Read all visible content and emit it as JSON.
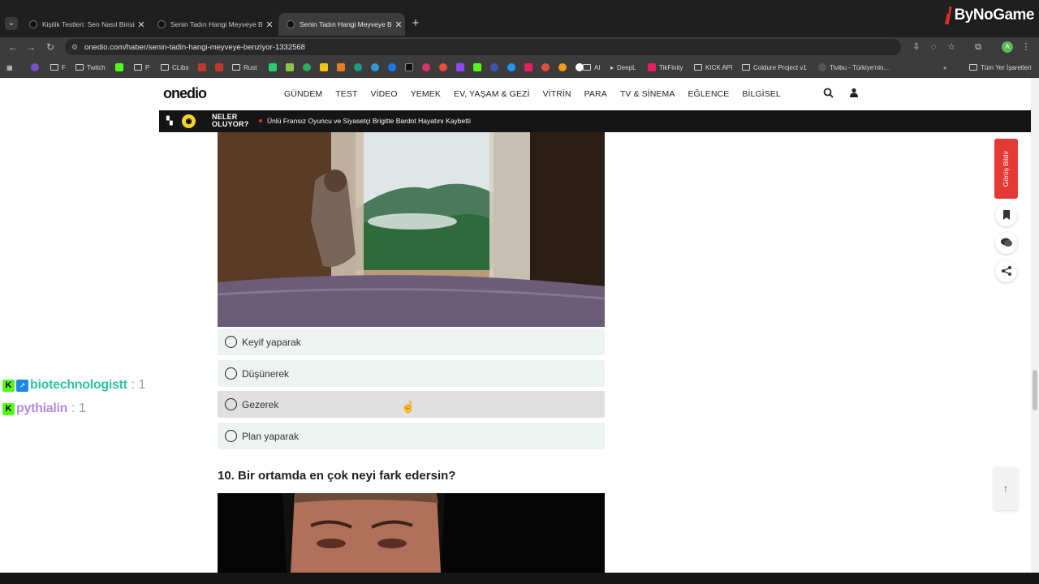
{
  "browser": {
    "tabs": [
      {
        "title": "Kişilik Testleri: Sen Nasıl Birisin?",
        "active": false
      },
      {
        "title": "Senin Tadın Hangi Meyveye Benziyor?",
        "active": false
      },
      {
        "title": "Senin Tadın Hangi Meyveye Benziyor?",
        "active": true
      }
    ],
    "new_tab": "+",
    "close_glyph": "✕",
    "url": "onedio.com/haber/senin-tadin-hangi-meyveye-benziyor-1332568",
    "profile_initial": "A",
    "bookmarks": {
      "items": [
        "F",
        "Twitch",
        "P",
        "CLibs",
        "Rust",
        "AI",
        "DeepL",
        "TikFinity",
        "KICK API",
        "Coldure Project v1",
        "Tivibu - Türkiye'nin..."
      ],
      "all_bookmarks": "Tüm Yer İşaretleri"
    }
  },
  "overlay_brand": "ByNoGame",
  "site": {
    "logo": "onedio",
    "menu": [
      "GÜNDEM",
      "TEST",
      "VİDEO",
      "YEMEK",
      "EV, YAŞAM & GEZİ",
      "VİTRİN",
      "PARA",
      "TV & SİNEMA",
      "EĞLENCE",
      "BİLGİSEL"
    ],
    "newsbar": {
      "badge": "NELER\nOLUYOR?",
      "badge_line1": "NELER",
      "badge_line2": "OLUYOR?",
      "headline": "Ünlü Fransız Oyuncu ve Siyasetçi Brigitte Bardot Hayatını Kaybetti"
    }
  },
  "quiz": {
    "options": [
      "Keyif yaparak",
      "Düşünerek",
      "Gezerek",
      "Plan yaparak"
    ],
    "hovered_option": "Gezerek",
    "next_question": "10. Bir ortamda en çok neyi fark edersin?"
  },
  "side": {
    "feedback": "Görüş Bildir"
  },
  "chat_overlay": [
    {
      "name": "biotechnologistt",
      "count": ": 1",
      "color": "#2ec4a6"
    },
    {
      "name": "pythialin",
      "count": ": 1",
      "color": "#b48be0"
    }
  ],
  "colors": {
    "accent_red": "#e53935",
    "option_bg": "#edf3f0",
    "kick_green": "#53fc18"
  }
}
